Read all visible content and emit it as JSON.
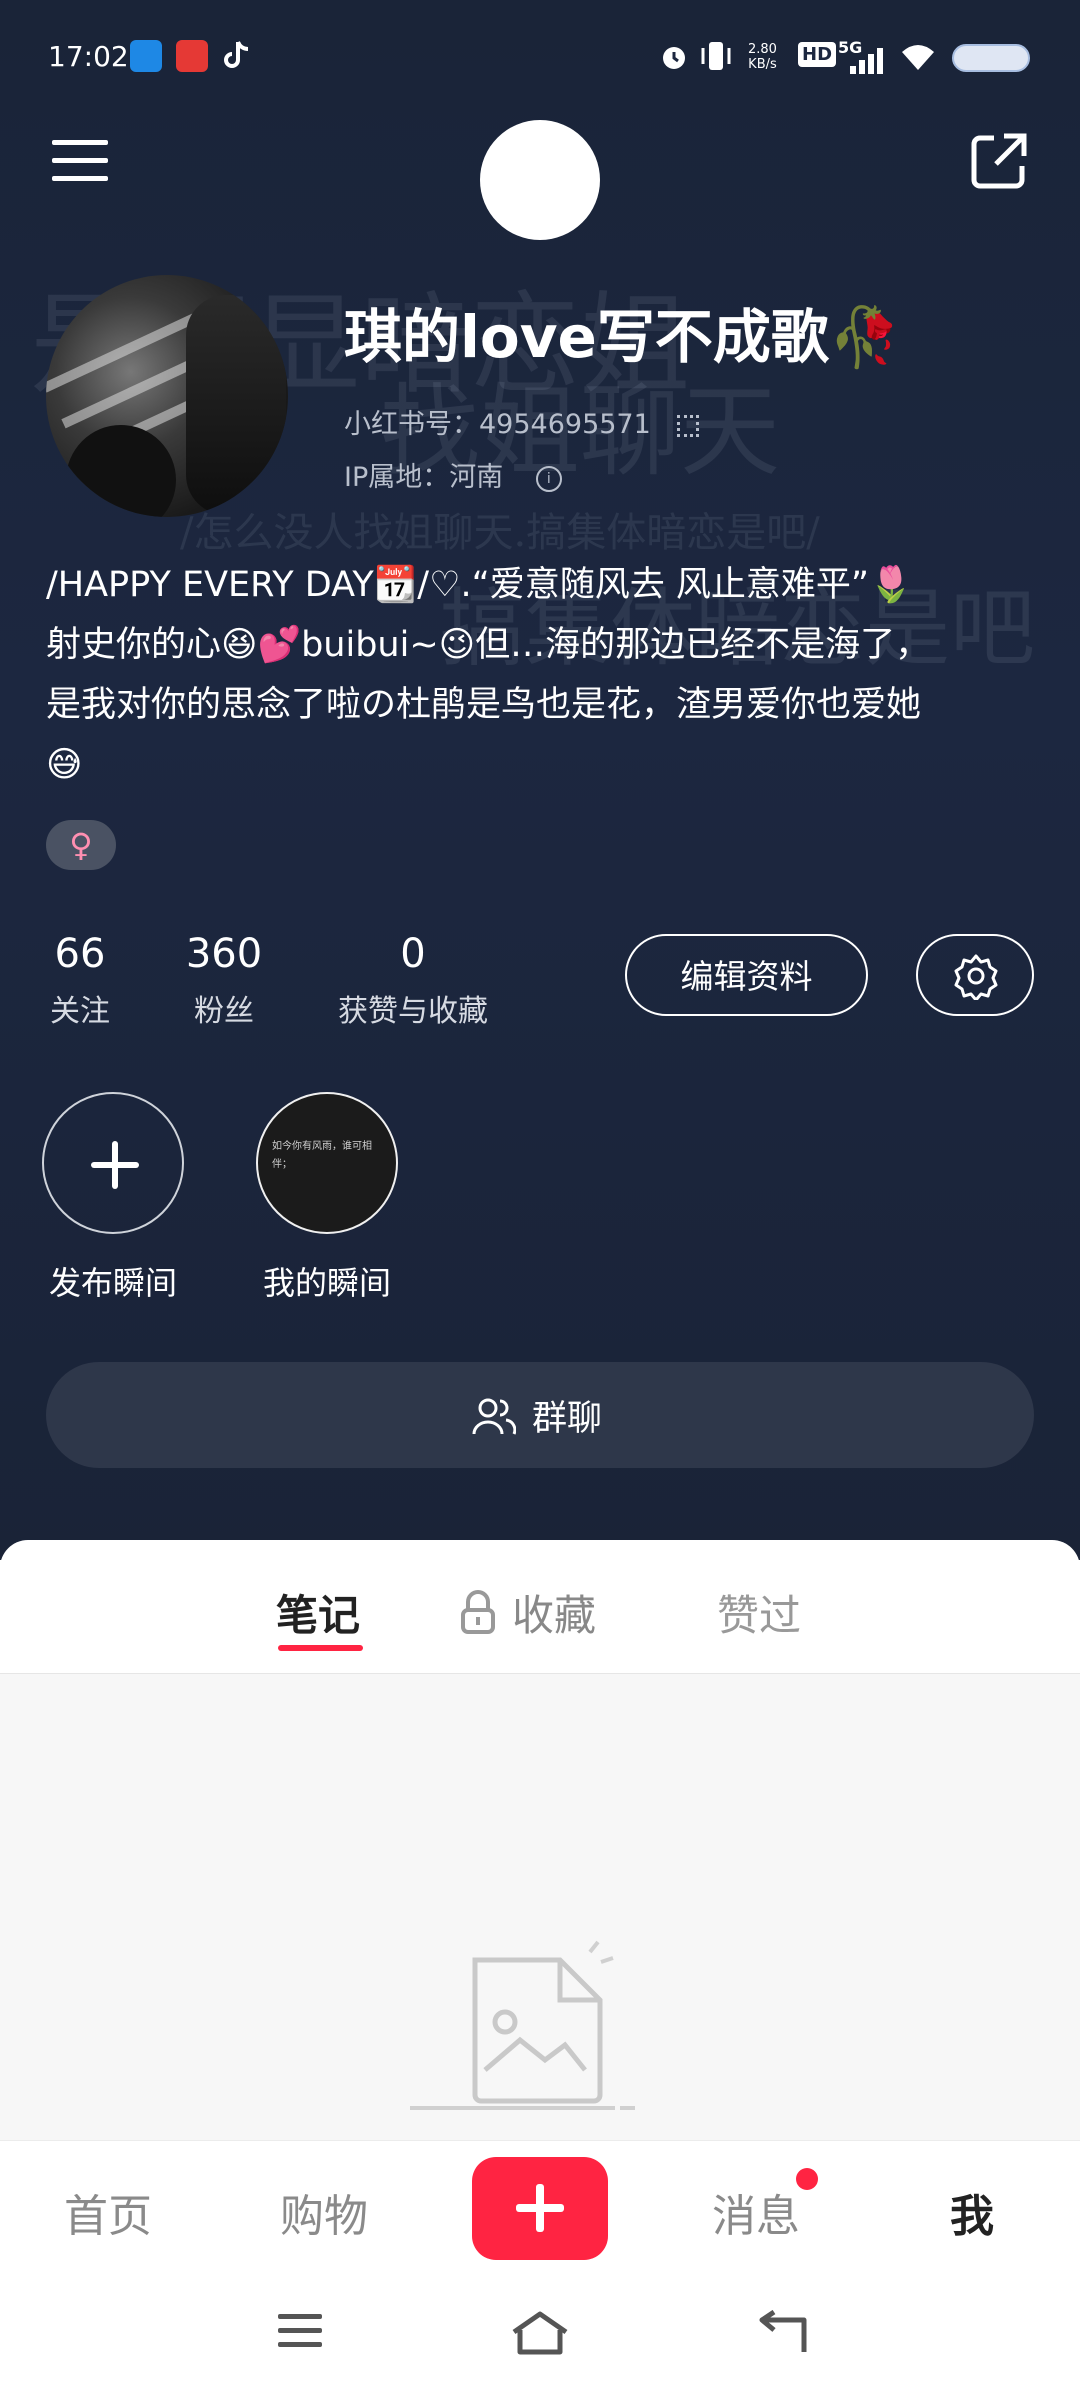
{
  "status_bar": {
    "time": "17:02",
    "network_speed_top": "2.80",
    "network_speed_bottom": "KB/s",
    "hd_label": "HD",
    "signal_label": "5G",
    "icons": [
      "pinned-app-icon",
      "taobao-icon",
      "tiktok-icon",
      "alarm-icon",
      "vibrate-icon",
      "signal-icon",
      "wifi-icon",
      "battery-icon"
    ]
  },
  "header": {
    "menu_icon": "hamburger-menu-icon",
    "share_icon": "share-external-icon"
  },
  "profile": {
    "username": "琪的love写不成歌🥀",
    "xhs_id_label": "小红书号：",
    "xhs_id": "4954695571",
    "ip_label": "IP属地：",
    "ip_location": "河南",
    "bio_lines": [
      "/HAPPY EVERY DAY📆/♡.“爱意随风去 风止意难平”🌷",
      "射史你的心😆💕buibui~😉但…海的那边已经不是海了，",
      "是我对你的思念了啦の杜鹃是鸟也是花，渣男爱你也爱她",
      "😅"
    ],
    "gender_symbol": "♀",
    "background_text": [
      "是否显暗恋姐",
      "找姐聊天",
      "/怎么没人找姐聊天.搞集体暗恋是吧/",
      "搞集体暗恋是吧"
    ]
  },
  "stats": [
    {
      "value": "66",
      "label": "关注"
    },
    {
      "value": "360",
      "label": "粉丝"
    },
    {
      "value": "0",
      "label": "获赞与收藏"
    }
  ],
  "actions": {
    "edit_profile": "编辑资料",
    "settings_icon": "gear-icon"
  },
  "moments": [
    {
      "label": "发布瞬间",
      "icon": "plus-icon"
    },
    {
      "label": "我的瞬间",
      "preview_text": "如今你有风雨，谁可相伴；"
    }
  ],
  "group_chat": {
    "label": "群聊",
    "icon": "people-icon"
  },
  "tabs": [
    {
      "label": "笔记",
      "active": true
    },
    {
      "label": "收藏",
      "icon": "lock-icon",
      "active": false
    },
    {
      "label": "赞过",
      "active": false
    }
  ],
  "bottom_nav": [
    {
      "label": "首页"
    },
    {
      "label": "购物"
    },
    {
      "label": "+",
      "icon": "plus-icon"
    },
    {
      "label": "消息",
      "badge": true
    },
    {
      "label": "我",
      "active": true
    }
  ],
  "colors": {
    "accent": "#ff2442",
    "hero_bg": "#1c2740",
    "group_bg": "#2e374a"
  }
}
